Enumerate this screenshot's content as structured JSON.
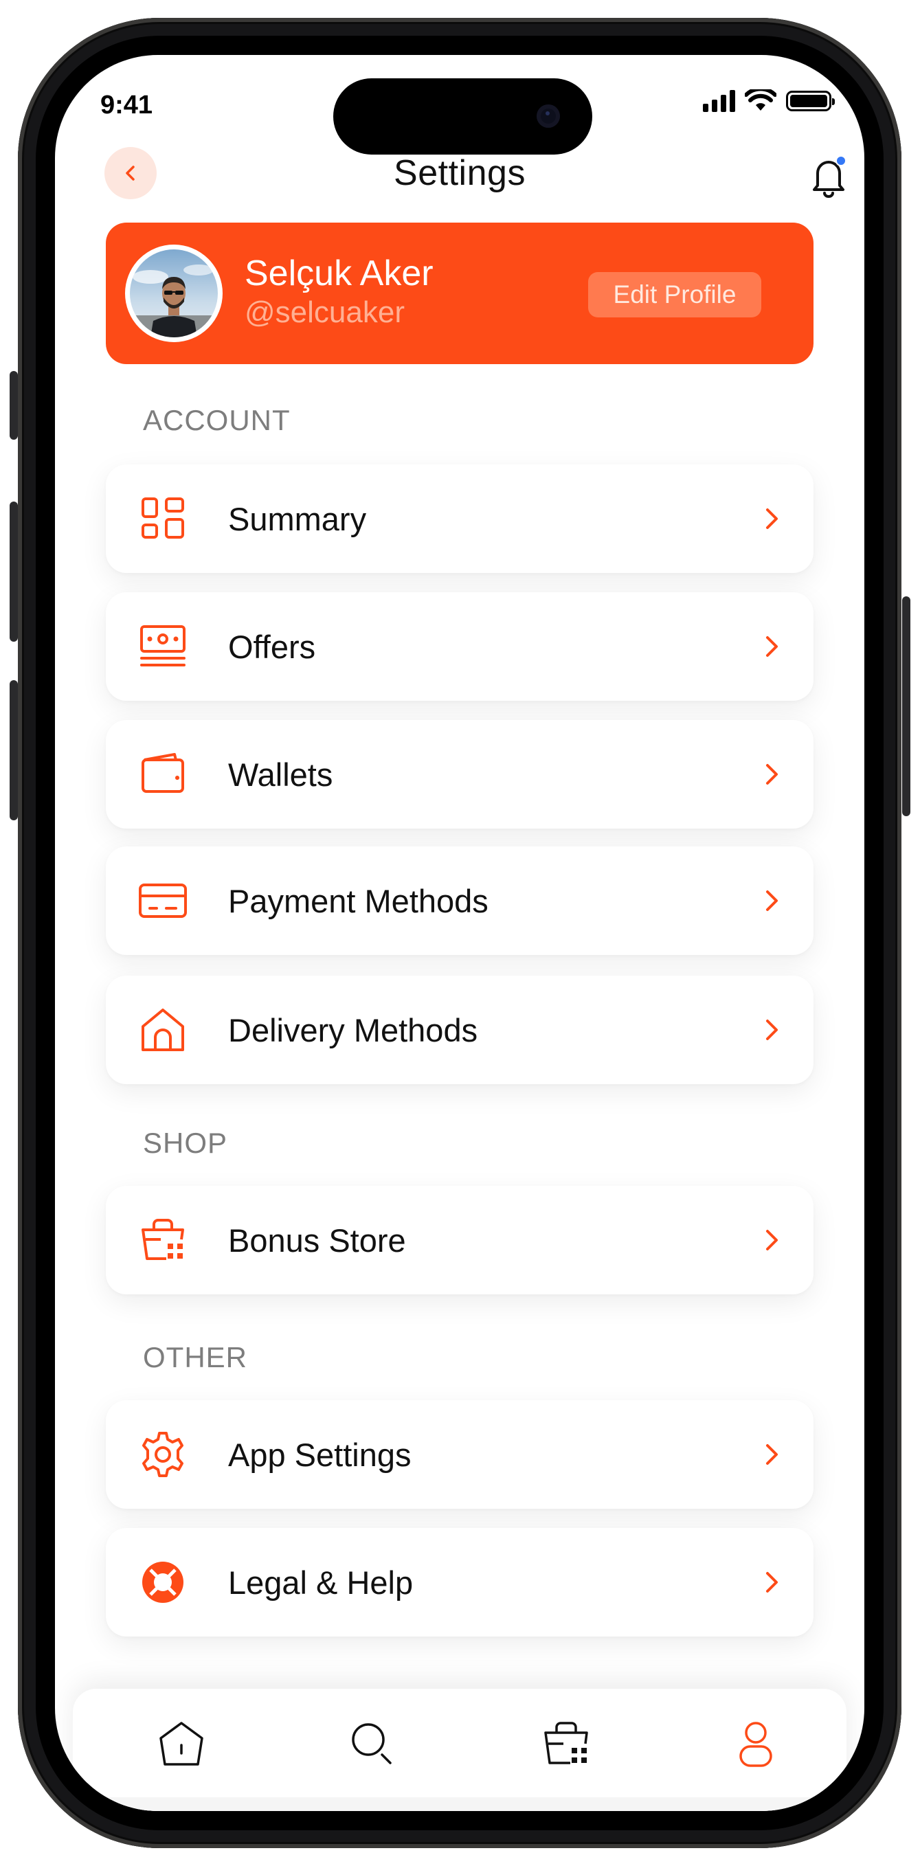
{
  "status_bar": {
    "time": "9:41"
  },
  "header": {
    "title": "Settings"
  },
  "profile": {
    "name": "Selçuk Aker",
    "handle": "@selcuaker",
    "edit_label": "Edit Profile"
  },
  "sections": [
    {
      "label": "ACCOUNT",
      "items": [
        {
          "label": "Summary",
          "icon": "grid-icon"
        },
        {
          "label": "Offers",
          "icon": "cash-icon"
        },
        {
          "label": "Wallets",
          "icon": "wallet-icon"
        },
        {
          "label": "Payment Methods",
          "icon": "card-icon"
        },
        {
          "label": "Delivery Methods",
          "icon": "home-icon"
        }
      ]
    },
    {
      "label": "SHOP",
      "items": [
        {
          "label": "Bonus Store",
          "icon": "store-icon"
        }
      ]
    },
    {
      "label": "OTHER",
      "items": [
        {
          "label": "App Settings",
          "icon": "gear-icon"
        },
        {
          "label": "Legal & Help",
          "icon": "lifebuoy-icon"
        }
      ]
    }
  ],
  "tabbar": {
    "items": [
      "home-icon",
      "search-icon",
      "store-icon",
      "profile-icon"
    ],
    "active": "profile-icon"
  },
  "colors": {
    "accent": "#fd4b17",
    "notification_dot": "#3478f6",
    "section_label": "#7d7d7d"
  }
}
